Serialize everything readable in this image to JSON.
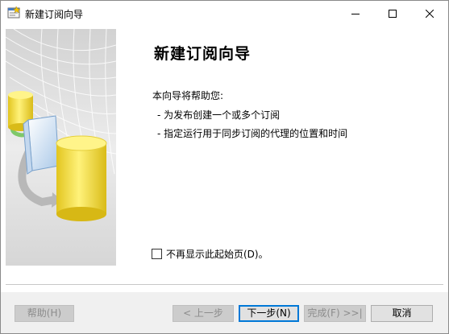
{
  "window": {
    "title": "新建订阅向导",
    "icon": "wizard-window-icon"
  },
  "titlebar": {
    "minimize_icon": "minimize-icon",
    "maximize_icon": "maximize-icon",
    "close_icon": "close-icon"
  },
  "content": {
    "heading": "新建订阅向导",
    "intro": "本向导将帮助您:",
    "bullets": [
      "-  为发布创建一个或多个订阅",
      "-  指定运行用于同步订阅的代理的位置和时间"
    ],
    "dont_show_label": "不再显示此起始页(D)。",
    "dont_show_checked": false
  },
  "buttons": {
    "help": "帮助(H)",
    "back": "< 上一步",
    "next": "下一步(N)",
    "finish": "完成(F) >>|",
    "cancel": "取消"
  },
  "colors": {
    "cylinder": "#f3df3a",
    "book": "#cfe3f5",
    "arrow_green": "#7ec86a",
    "focus_border": "#0078d7"
  }
}
